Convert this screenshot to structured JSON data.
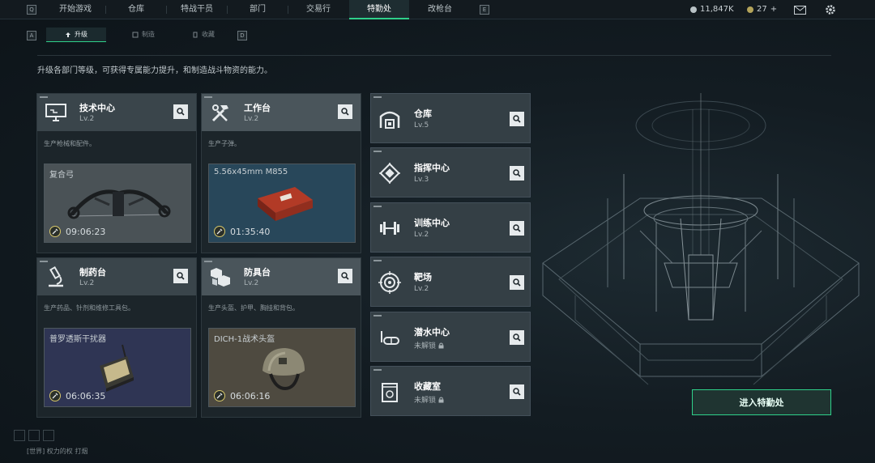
{
  "top_nav": {
    "key_left": "Q",
    "key_right": "E",
    "tabs": [
      {
        "label": "开始游戏",
        "active": false
      },
      {
        "label": "仓库",
        "active": false
      },
      {
        "label": "特战干员",
        "active": false
      },
      {
        "label": "部门",
        "active": false
      },
      {
        "label": "交易行",
        "active": false
      },
      {
        "label": "特勤处",
        "active": true
      },
      {
        "label": "改枪台",
        "active": false
      }
    ]
  },
  "currency": {
    "money": "11,847K",
    "tokens": "27",
    "add_symbol": "+"
  },
  "sub_nav": {
    "key_left": "A",
    "key_right": "D",
    "tabs": [
      {
        "label": "升级",
        "active": true
      },
      {
        "label": "制造",
        "active": false
      },
      {
        "label": "收藏",
        "active": false
      }
    ]
  },
  "description": "升级各部门等级，可获得专属能力提升，和制造战斗物资的能力。",
  "departments": [
    {
      "name": "技术中心",
      "level": "Lv.2",
      "desc": "生产枪械和配件。",
      "craft_item": "复合弓",
      "timer": "09:06:23",
      "icon": "computer-icon",
      "box_color": "#4a5256"
    },
    {
      "name": "工作台",
      "level": "Lv.2",
      "desc": "生产子弹。",
      "craft_item": "5.56x45mm M855",
      "timer": "01:35:40",
      "icon": "tools-icon",
      "box_color": "#28475a"
    },
    {
      "name": "制药台",
      "level": "Lv.2",
      "desc": "生产药品、针剂和维修工具包。",
      "craft_item": "普罗透斯干扰器",
      "timer": "06:06:35",
      "icon": "microscope-icon",
      "box_color": "#2f3554"
    },
    {
      "name": "防具台",
      "level": "Lv.2",
      "desc": "生产头盔、护甲、胸挂和背包。",
      "craft_item": "DICH-1战术头盔",
      "timer": "06:06:16",
      "icon": "cubes-icon",
      "box_color": "#4e4a40"
    }
  ],
  "facilities": [
    {
      "name": "仓库",
      "level": "Lv.5",
      "locked": false,
      "icon": "warehouse-icon"
    },
    {
      "name": "指挥中心",
      "level": "Lv.3",
      "locked": false,
      "icon": "chip-icon"
    },
    {
      "name": "训练中心",
      "level": "Lv.2",
      "locked": false,
      "icon": "dumbbell-icon"
    },
    {
      "name": "靶场",
      "level": "Lv.2",
      "locked": false,
      "icon": "target-icon"
    },
    {
      "name": "潜水中心",
      "level": "未解锁",
      "locked": true,
      "icon": "diving-mask-icon"
    },
    {
      "name": "收藏室",
      "level": "未解锁",
      "locked": true,
      "icon": "trophy-case-icon"
    }
  ],
  "enter_button": "进入特勤处",
  "chat": {
    "channel": "[世界]",
    "message": "权力的权  打烟"
  },
  "colors": {
    "accent": "#2fd08a",
    "card_header": "#3a454b",
    "background": "#131c22"
  }
}
